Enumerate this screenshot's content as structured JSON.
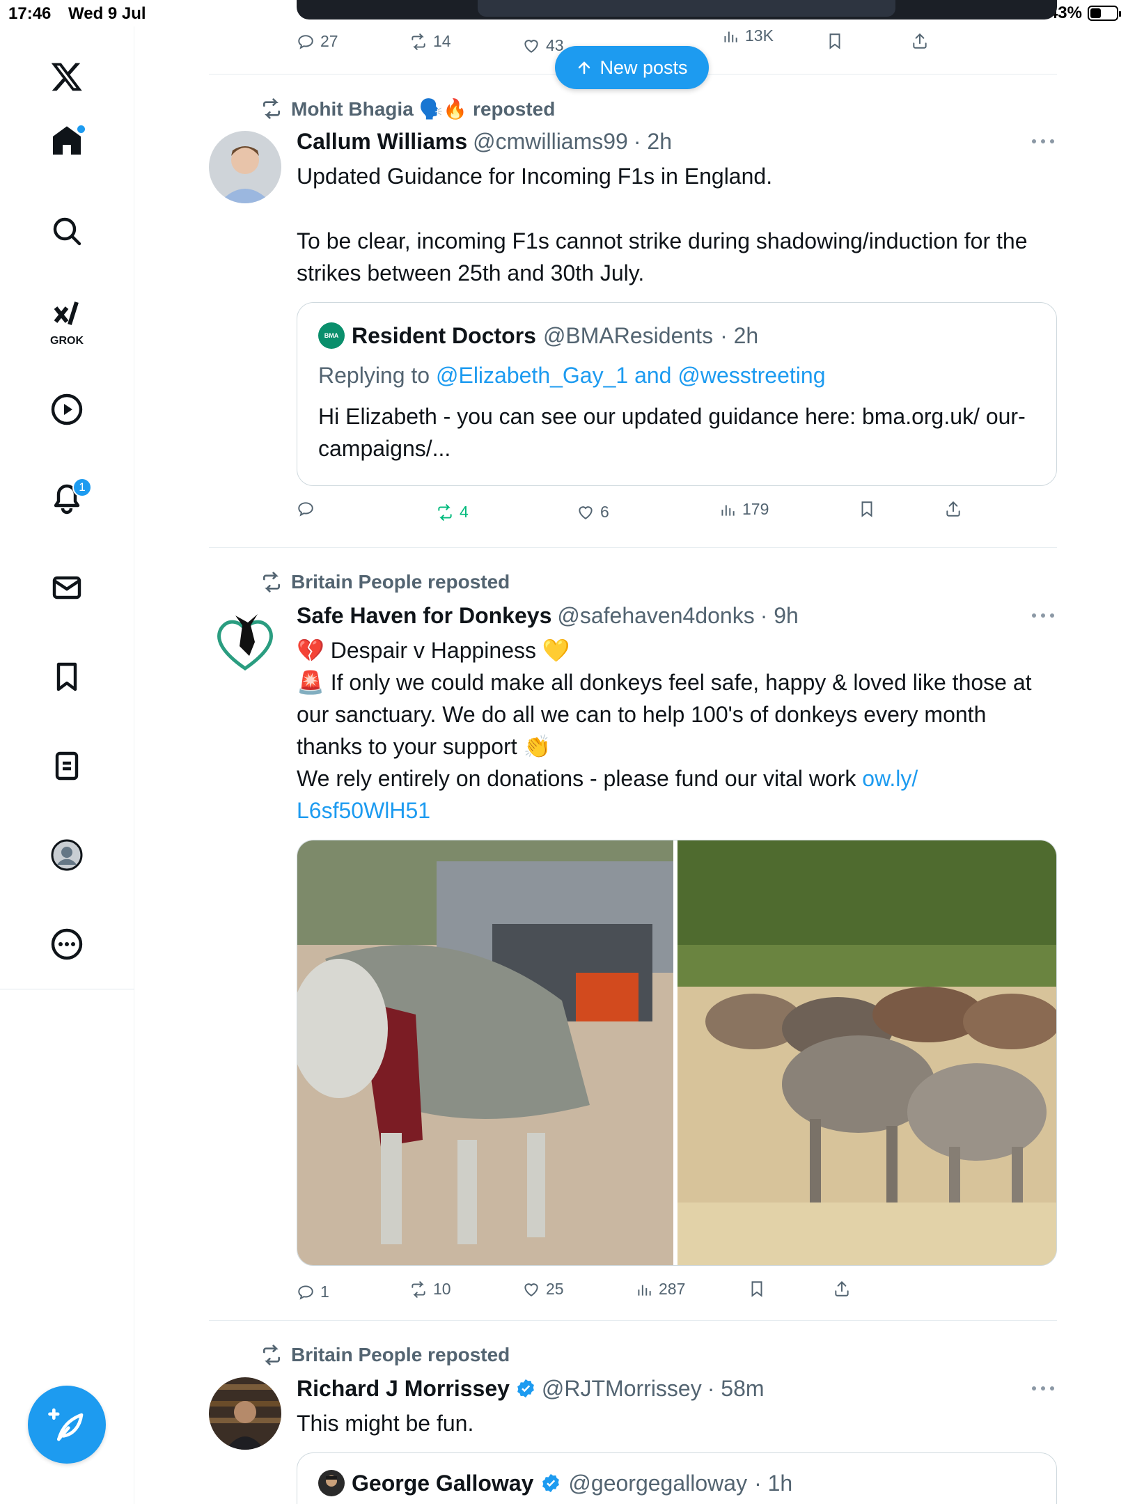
{
  "status_bar": {
    "time": "17:46",
    "date": "Wed 9 Jul",
    "battery": "43%",
    "battery_level": 0.43
  },
  "sidebar": {
    "items": [
      {
        "name": "x-logo",
        "label": ""
      },
      {
        "name": "home",
        "label": ""
      },
      {
        "name": "search",
        "label": ""
      },
      {
        "name": "grok",
        "label": "GROK"
      },
      {
        "name": "video",
        "label": ""
      },
      {
        "name": "notifications",
        "badge": "1"
      },
      {
        "name": "messages",
        "label": ""
      },
      {
        "name": "bookmarks",
        "label": ""
      },
      {
        "name": "lists",
        "label": ""
      },
      {
        "name": "profile",
        "label": ""
      },
      {
        "name": "more",
        "label": ""
      }
    ],
    "notifications_badge": "1",
    "grok_label": "GROK"
  },
  "new_posts": {
    "label": "New posts"
  },
  "posts": [
    {
      "actions": {
        "replies": "27",
        "reposts": "14",
        "likes": "43",
        "views": "13K"
      }
    },
    {
      "reposted_by": "Mohit Bhagia 🗣️🔥 reposted",
      "name": "Callum Williams",
      "handle": "@cmwilliams99",
      "time": "· 2h",
      "text_1": "Updated Guidance for Incoming F1s in England.",
      "text_2": "To be clear, incoming F1s cannot strike during shadowing/induction for the strikes between 25th and 30th July.",
      "quote": {
        "logo": "BMA",
        "name": "Resident Doctors",
        "handle": "@BMAResidents",
        "time": "· 2h",
        "replying_prefix": "Replying to ",
        "replying_to": "@Elizabeth_Gay_1 and @wesstreeting",
        "text": "Hi Elizabeth - you can see our updated guidance here: bma.org.uk/ our-campaigns/..."
      },
      "actions": {
        "replies": "",
        "reposts": "4",
        "likes": "6",
        "views": "179"
      }
    },
    {
      "reposted_by": "Britain People reposted",
      "name": "Safe Haven for Donkeys",
      "handle": "@safehaven4donks",
      "time": "· 9h",
      "line_1": "💔 Despair v Happiness 💛",
      "line_2": "🚨 If only we could make all donkeys feel safe, happy & loved like those at our sanctuary. We do all we can to help 100's of donkeys every month thanks to your support 👏",
      "line_3": "We rely entirely on donations - please fund our vital work ",
      "link": "ow.ly/ L6sf50WlH51",
      "actions": {
        "replies": "1",
        "reposts": "10",
        "likes": "25",
        "views": "287"
      }
    },
    {
      "reposted_by": "Britain People reposted",
      "name": "Richard J Morrissey",
      "handle": "@RJTMorrissey",
      "time": "· 58m",
      "text": "This might be fun.",
      "quote": {
        "name": "George Galloway",
        "handle": "@georgegalloway",
        "time": "· 1h"
      }
    }
  ],
  "colors": {
    "accent": "#1d9bf0",
    "repost_green": "#00ba7c",
    "muted": "#536471",
    "text": "#0f1419"
  }
}
